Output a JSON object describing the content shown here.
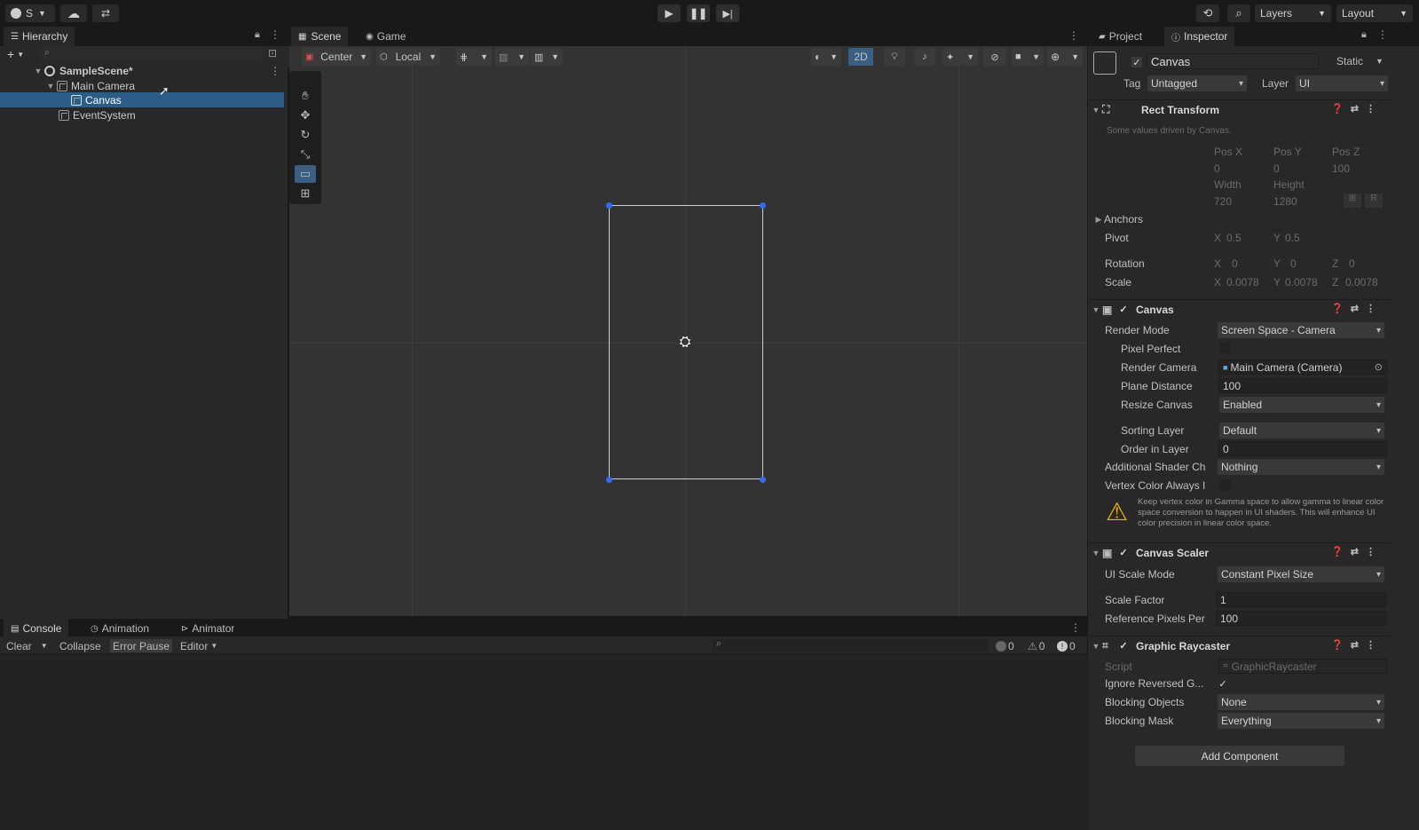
{
  "toolbar": {
    "account_label": "S",
    "layers_label": "Layers",
    "layout_label": "Layout"
  },
  "hierarchy": {
    "tab": "Hierarchy",
    "items": [
      {
        "label": "SampleScene*"
      },
      {
        "label": "Main Camera"
      },
      {
        "label": "Canvas"
      },
      {
        "label": "EventSystem"
      }
    ]
  },
  "scene": {
    "tabs": [
      "Scene",
      "Game"
    ],
    "pivot_label": "Center",
    "space_label": "Local",
    "mode_2d": "2D"
  },
  "inspector": {
    "tabs": [
      "Project",
      "Inspector"
    ],
    "object_name": "Canvas",
    "static_label": "Static",
    "tag_label": "Tag",
    "tag_value": "Untagged",
    "layer_label": "Layer",
    "layer_value": "UI",
    "rect_transform": {
      "title": "Rect Transform",
      "note": "Some values driven by Canvas.",
      "pos_x_label": "Pos X",
      "pos_y_label": "Pos Y",
      "pos_z_label": "Pos Z",
      "pos_x": "0",
      "pos_y": "0",
      "pos_z": "100",
      "width_label": "Width",
      "height_label": "Height",
      "width": "720",
      "height": "1280",
      "anchors_label": "Anchors",
      "pivot_label": "Pivot",
      "pivot_x": "0.5",
      "pivot_y": "0.5",
      "rotation_label": "Rotation",
      "rot_x": "0",
      "rot_y": "0",
      "rot_z": "0",
      "scale_label": "Scale",
      "scale_x": "0.0078",
      "scale_y": "0.0078",
      "scale_z": "0.0078"
    },
    "canvas": {
      "title": "Canvas",
      "render_mode_label": "Render Mode",
      "render_mode": "Screen Space - Camera",
      "pixel_perfect_label": "Pixel Perfect",
      "render_camera_label": "Render Camera",
      "render_camera": "Main Camera (Camera)",
      "plane_distance_label": "Plane Distance",
      "plane_distance": "100",
      "resize_canvas_label": "Resize Canvas",
      "resize_canvas": "Enabled",
      "sorting_layer_label": "Sorting Layer",
      "sorting_layer": "Default",
      "order_in_layer_label": "Order in Layer",
      "order_in_layer": "0",
      "additional_shader_label": "Additional Shader Ch",
      "additional_shader": "Nothing",
      "vertex_color_label": "Vertex Color Always I",
      "warning": "Keep vertex color in Gamma space to allow gamma to linear color space conversion to happen in UI shaders. This will enhance UI color precision in linear color space."
    },
    "canvas_scaler": {
      "title": "Canvas Scaler",
      "ui_scale_mode_label": "UI Scale Mode",
      "ui_scale_mode": "Constant Pixel Size",
      "scale_factor_label": "Scale Factor",
      "scale_factor": "1",
      "ref_ppu_label": "Reference Pixels Per",
      "ref_ppu": "100"
    },
    "graphic_raycaster": {
      "title": "Graphic Raycaster",
      "script_label": "Script",
      "script": "GraphicRaycaster",
      "ignore_reversed_label": "Ignore Reversed G...",
      "blocking_objects_label": "Blocking Objects",
      "blocking_objects": "None",
      "blocking_mask_label": "Blocking Mask",
      "blocking_mask": "Everything"
    },
    "add_component": "Add Component"
  },
  "console": {
    "tabs": [
      "Console",
      "Animation",
      "Animator"
    ],
    "clear": "Clear",
    "collapse": "Collapse",
    "error_pause": "Error Pause",
    "editor": "Editor",
    "count_log": "0",
    "count_warn": "0",
    "count_err": "0"
  },
  "colors": {
    "selection": "#2c5d87",
    "handle": "#2f6bff",
    "warning": "#f2b100"
  }
}
